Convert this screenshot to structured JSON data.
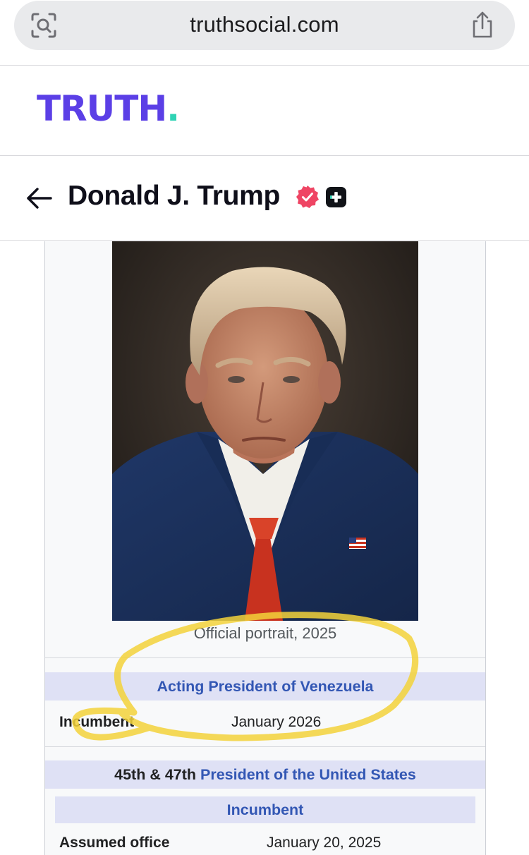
{
  "browser": {
    "url": "truthsocial.com",
    "lens_icon": "visual-lookup-icon",
    "share_icon": "share-icon"
  },
  "header": {
    "logo_text": "TRUTH",
    "logo_dot": ".",
    "brand_color": "#5b3fe6",
    "accent_color": "#2fd3b4"
  },
  "profile": {
    "back_icon": "back-arrow-icon",
    "name": "Donald J. Trump",
    "verified_icon": "verified-badge-icon",
    "verified_color": "#ef4564",
    "plus_icon": "truth-plus-icon"
  },
  "infobox": {
    "caption": "Official portrait, 2025",
    "office1": {
      "title": "Acting President of Venezuela",
      "label": "Incumbent",
      "value": "January 2026"
    },
    "office2": {
      "prefix": "45th & 47th ",
      "title": "President of the United States",
      "status": "Incumbent",
      "label": "Assumed office",
      "value": "January 20, 2025"
    },
    "band_color": "#dfe1f5",
    "link_color": "#3357b4",
    "highlight_color": "#f3d23a"
  }
}
